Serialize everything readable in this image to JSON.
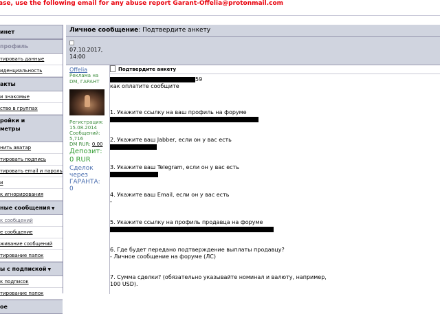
{
  "banner": "ase, use the following email for any abuse report Garant-Offelia@protonmail.com",
  "sidebar": {
    "sections": [
      {
        "title": "инет",
        "style": "head",
        "items": []
      },
      {
        "title": "профиль",
        "style": "muted",
        "items": [
          "тировать данные",
          "иденциальность"
        ]
      },
      {
        "title": "акты",
        "style": "head",
        "items": [
          "и знакомые",
          "ство в группах"
        ]
      },
      {
        "title": "ройки и\nметры",
        "style": "tall",
        "items": [
          "нить аватар",
          "тировать подпись",
          "тировать email и пароль",
          "и",
          "к игнорирования"
        ]
      },
      {
        "title": "ные сообщения",
        "style": "head",
        "arrow": "▼",
        "items": [
          "к сообщений",
          "е сообщение",
          "живание сообщений",
          "тирование папок"
        ]
      },
      {
        "title": "ы с подпиской",
        "style": "head",
        "arrow": "▼",
        "items": [
          "к подписок",
          "тирование папок"
        ]
      },
      {
        "title": "ое",
        "style": "head",
        "items": []
      }
    ]
  },
  "main": {
    "title_bold": "Личное сообщение",
    "title_rest": ": Подтвердите анкету",
    "date_line1": "07.10.2017,",
    "date_line2": "14:00",
    "author": {
      "name": "Offelia",
      "rank": "Реклама на DM, ГАРАНТ",
      "reg_label": "Регистрация:",
      "reg_date": "15.08.2014",
      "posts_label": "Сообщений:",
      "posts": "5,716",
      "dm_label": "DM RUR:",
      "dm_value": "0.00",
      "deposit_label": "Депозит:",
      "deposit_value": "0 RUR",
      "deals_label": "Сделок через ГАРАНТА:",
      "deals_value": "0"
    },
    "message": {
      "subject": "Подтвердите анкету",
      "lines": [
        "59",
        "как оплатите сообщите",
        "1. Укажите ссылку на ваш профиль на форуме",
        "2. Укажите ваш Jabber, если он у вас есть",
        "3. Укажите ваш Telegram, если он у вас есть",
        "4. Укажите ваш Email, если он у вас есть",
        "-",
        "5. Укажите ссылку на профиль продавца на форуме",
        "6. Где будет передано подтверждение выплаты продавцу?",
        "- Личное сообщение на форуме (ЛС)",
        "7. Сумма сделки? (обязательно указывайте номинал и валюту, например,",
        "100 USD)."
      ]
    }
  }
}
